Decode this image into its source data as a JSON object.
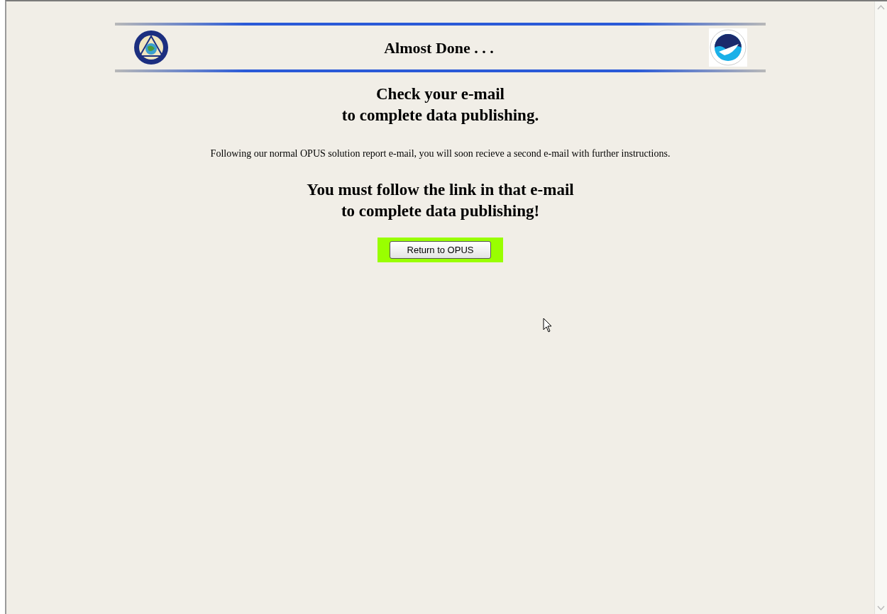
{
  "header": {
    "title": "Almost Done . . ."
  },
  "heading": [
    "Check your e-mail",
    "to complete data publishing."
  ],
  "message": "Following our normal OPUS solution report e-mail, you will soon recieve a second e-mail with further instructions.",
  "warning": [
    "You must follow the link in that e-mail",
    "to complete data publishing!"
  ],
  "button": {
    "label": "Return to OPUS"
  }
}
